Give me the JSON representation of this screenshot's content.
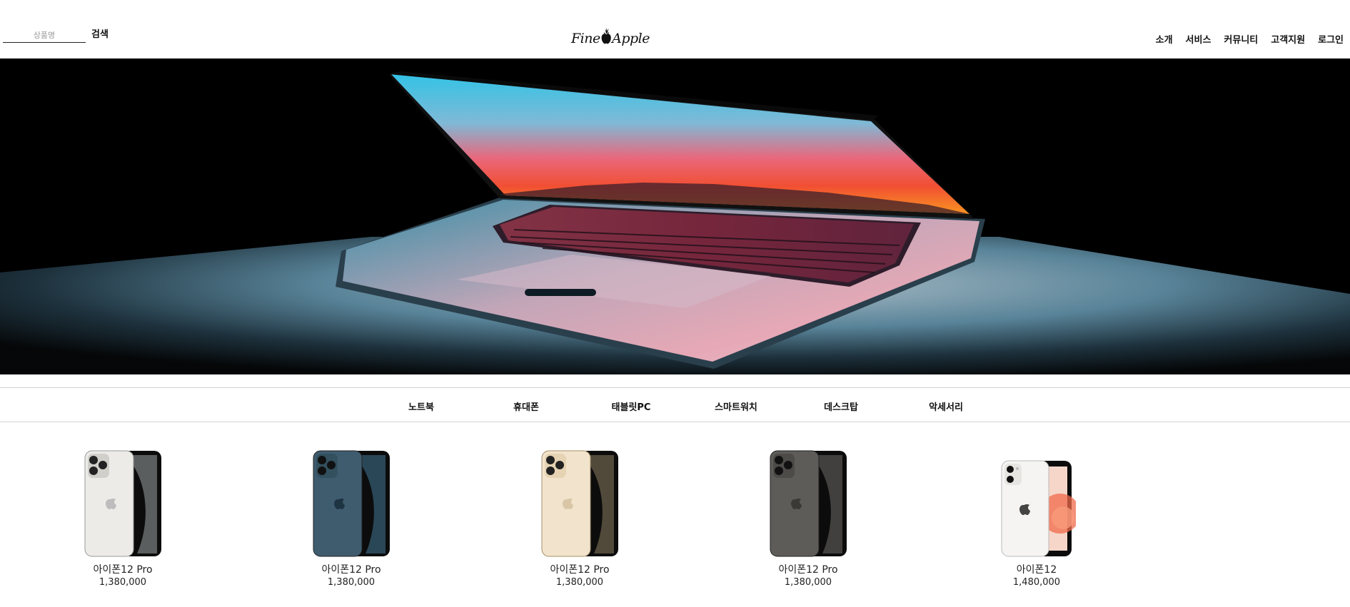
{
  "header": {
    "search": {
      "placeholder": "상품명",
      "button_label": "검색"
    },
    "logo": {
      "left": "Fine",
      "right": "Apple",
      "icon": "pineapple-apple-icon"
    },
    "nav": [
      "소개",
      "서비스",
      "커뮤니티",
      "고객지원",
      "로그인"
    ]
  },
  "hero": {
    "image": "laptop-half-open-photo"
  },
  "categories": [
    "노트북",
    "휴대폰",
    "태블릿PC",
    "스마트워치",
    "데스크탑",
    "악세서리"
  ],
  "products": [
    {
      "name": "아이폰12 Pro",
      "price": "1,380,000",
      "color": "#ecebe7"
    },
    {
      "name": "아이폰12 Pro",
      "price": "1,380,000",
      "color": "#3f5c6f"
    },
    {
      "name": "아이폰12 Pro",
      "price": "1,380,000",
      "color": "#f2e4cc"
    },
    {
      "name": "아이폰12 Pro",
      "price": "1,380,000",
      "color": "#5d5c58"
    },
    {
      "name": "아이폰12",
      "price": "1,480,000",
      "color": "#f5f4f2"
    }
  ]
}
